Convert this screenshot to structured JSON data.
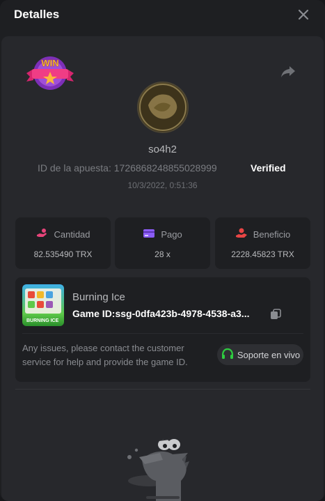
{
  "header": {
    "title": "Detalles"
  },
  "bet": {
    "username": "so4h2",
    "id_label": "ID de la apuesta:",
    "id_value": "1726868248855028999",
    "verified_label": "Verified",
    "datetime": "10/3/2022, 0:51:36",
    "badge_text": "WIN"
  },
  "stats": [
    {
      "label": "Cantidad",
      "value": "82.535490 TRX",
      "icon": "hand-coins-icon",
      "color": "#e8447a"
    },
    {
      "label": "Pago",
      "value": "28 x",
      "icon": "card-icon",
      "color": "#8b5cf6"
    },
    {
      "label": "Beneficio",
      "value": "2228.45823 TRX",
      "icon": "profit-hand-icon",
      "color": "#e94545"
    }
  ],
  "game": {
    "name": "Burning Ice",
    "id_label": "Game ID:",
    "id_value": "ssg-0dfa423b-4978-4538-a3...",
    "thumb_text": "BURNING ICE"
  },
  "support": {
    "text": "Any issues, please contact the customer service for help and provide the game ID.",
    "button_label": "Soporte en vivo"
  },
  "colors": {
    "background": "#1e1f22",
    "panel": "#27282c",
    "card": "#1e1f22",
    "support_icon": "#2ecc40"
  }
}
